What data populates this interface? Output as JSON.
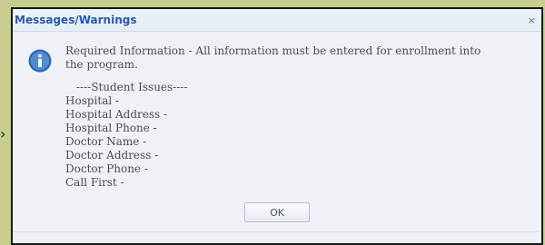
{
  "window": {
    "title": "Messages/Warnings",
    "close_icon": "×"
  },
  "message": {
    "text": "Required Information - All information must be entered for enrollment into the program.",
    "section_header": "----Student Issues----",
    "issues": [
      "Hospital -",
      "Hospital Address -",
      "Hospital Phone -",
      "Doctor Name -",
      "Doctor Address -",
      "Doctor Phone -",
      "Call First -"
    ]
  },
  "actions": {
    "ok_label": "OK"
  },
  "icons": {
    "info_icon": "information-icon",
    "close_icon_name": "close-icon",
    "side_arrow": "arrow-right-icon"
  },
  "colors": {
    "backdrop": "#c7cc8f",
    "dialog_background": "#eef1f5",
    "title_text": "#2a5aa8",
    "info_icon_blue": "#2d68b2"
  }
}
